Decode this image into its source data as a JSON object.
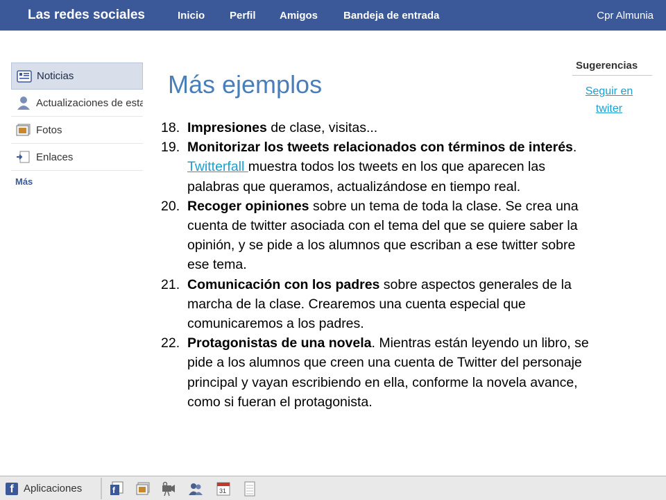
{
  "topbar": {
    "brand": "Las redes sociales",
    "nav": [
      "Inicio",
      "Perfil",
      "Amigos",
      "Bandeja de entrada"
    ],
    "user": "Cpr Almunia"
  },
  "sidebar": {
    "items": [
      {
        "label": "Noticias",
        "icon": "news-feed-icon",
        "active": true
      },
      {
        "label": "Actualizaciones de estado",
        "icon": "status-updates-icon"
      },
      {
        "label": "Fotos",
        "icon": "photos-icon"
      },
      {
        "label": "Enlaces",
        "icon": "links-icon"
      }
    ],
    "more": "Más"
  },
  "suggestions": {
    "title": "Sugerencias",
    "link": "Seguir en twiter"
  },
  "main": {
    "title": "Más ejemplos",
    "items": [
      {
        "num": "18.",
        "bold": "Impresiones",
        "text": " de clase, visitas..."
      },
      {
        "num": "19.",
        "bold": "Monitorizar los tweets relacionados con términos de interés",
        "text": ". ",
        "link": "Twitterfall ",
        "after": "muestra todos los tweets en los que aparecen las palabras que queramos, actualizándose en tiempo real."
      },
      {
        "num": "20.",
        "bold": "Recoger opiniones",
        "text": " sobre un tema de toda la clase. Se crea una cuenta de twitter asociada con el tema del que se quiere saber la opinión, y se pide a los alumnos que escriban a ese twitter sobre ese tema."
      },
      {
        "num": "21.",
        "bold": "Comunicación con los padres",
        "text": " sobre aspectos generales de la marcha de la clase. Crearemos una cuenta especial que comunicaremos a los padres."
      },
      {
        "num": "22.",
        "bold": "Protagonistas de una novela",
        "text": ". Mientras están leyendo un libro, se pide a los alumnos que creen una cuenta de Twitter del personaje principal y vayan escribiendo en ella, conforme la novela avance, como si fueran el protagonista."
      }
    ]
  },
  "bottombar": {
    "logo": "f",
    "apps_label": "Aplicaciones",
    "calendar_day": "31",
    "icons": [
      "pages-icon",
      "photos-icon",
      "video-icon",
      "friends-icon",
      "calendar-icon",
      "notes-icon"
    ]
  },
  "colors": {
    "brand": "#3b5998",
    "title": "#4a7ebb",
    "link": "#1a9fd0"
  }
}
